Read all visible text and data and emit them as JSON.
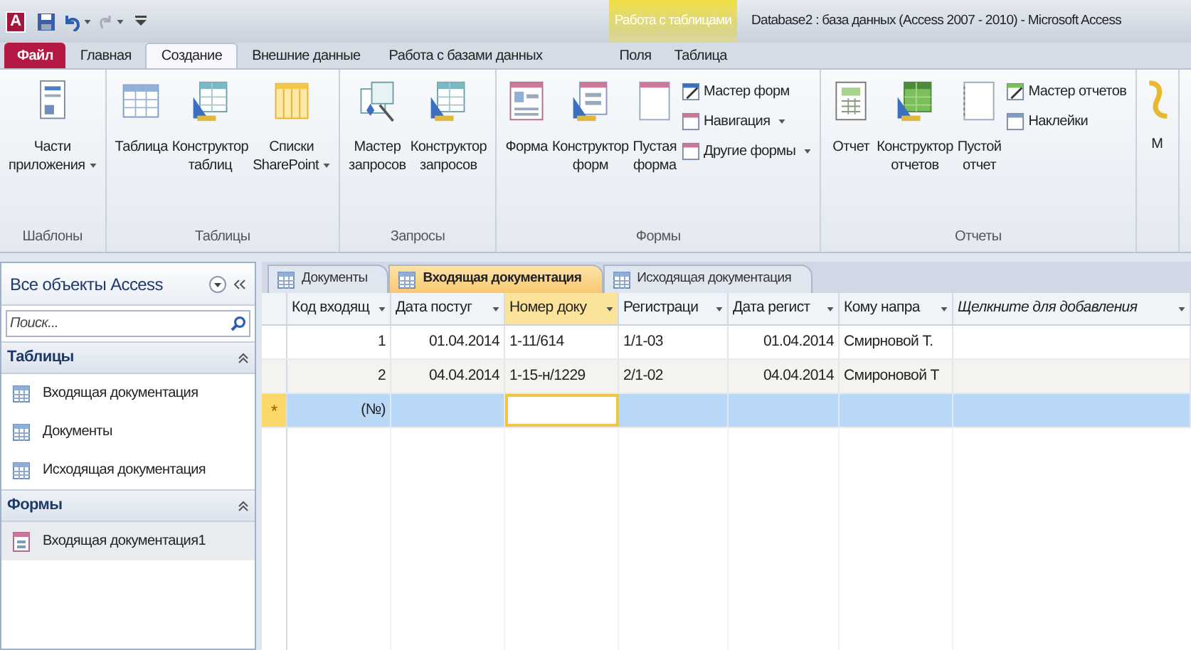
{
  "title_bar": {
    "app_logo": "A",
    "context_group": "Работа с таблицами",
    "title": "Database2 : база данных (Access 2007 - 2010)  -  Microsoft Access"
  },
  "ribbon_tabs": [
    {
      "label": "Файл",
      "kind": "file",
      "selected": false
    },
    {
      "label": "Главная",
      "kind": "normal",
      "selected": false
    },
    {
      "label": "Создание",
      "kind": "normal",
      "selected": true
    },
    {
      "label": "Внешние данные",
      "kind": "normal",
      "selected": false
    },
    {
      "label": "Работа с базами данных",
      "kind": "normal",
      "selected": false
    },
    {
      "label": "Поля",
      "kind": "context",
      "selected": false
    },
    {
      "label": "Таблица",
      "kind": "context",
      "selected": false
    }
  ],
  "ribbon_groups": [
    {
      "label": "Шаблоны",
      "buttons": [
        {
          "lines": [
            "Части",
            "приложения"
          ],
          "dropdown": true
        }
      ]
    },
    {
      "label": "Таблицы",
      "buttons": [
        {
          "lines": [
            "Таблица"
          ],
          "dropdown": false
        },
        {
          "lines": [
            "Конструктор",
            "таблиц"
          ],
          "dropdown": false
        },
        {
          "lines": [
            "Списки",
            "SharePoint"
          ],
          "dropdown": true
        }
      ]
    },
    {
      "label": "Запросы",
      "buttons": [
        {
          "lines": [
            "Мастер",
            "запросов"
          ],
          "dropdown": false
        },
        {
          "lines": [
            "Конструктор",
            "запросов"
          ],
          "dropdown": false
        }
      ]
    },
    {
      "label": "Формы",
      "buttons": [
        {
          "lines": [
            "Форма"
          ],
          "dropdown": false
        },
        {
          "lines": [
            "Конструктор",
            "форм"
          ],
          "dropdown": false
        },
        {
          "lines": [
            "Пустая",
            "форма"
          ],
          "dropdown": false
        }
      ],
      "small_buttons": [
        {
          "label": "Мастер форм",
          "dropdown": false
        },
        {
          "label": "Навигация",
          "dropdown": true
        },
        {
          "label": "Другие формы",
          "dropdown": true
        }
      ]
    },
    {
      "label": "Отчеты",
      "buttons": [
        {
          "lines": [
            "Отчет"
          ],
          "dropdown": false
        },
        {
          "lines": [
            "Конструктор",
            "отчетов"
          ],
          "dropdown": false
        },
        {
          "lines": [
            "Пустой",
            "отчет"
          ],
          "dropdown": false
        }
      ],
      "small_buttons": [
        {
          "label": "Мастер отчетов",
          "dropdown": false
        },
        {
          "label": "Наклейки",
          "dropdown": false
        }
      ]
    },
    {
      "buttons": [
        {
          "lines": [
            "М"
          ],
          "dropdown": false
        }
      ]
    }
  ],
  "nav_pane": {
    "title": "Все объекты Access",
    "search": {
      "placeholder": "Поиск..."
    },
    "groups": [
      {
        "label": "Таблицы",
        "expanded": true,
        "items": [
          {
            "label": "Входящая документация",
            "kind": "table",
            "selected": false
          },
          {
            "label": "Документы",
            "kind": "table",
            "selected": false
          },
          {
            "label": "Исходящая документация",
            "kind": "table",
            "selected": false
          }
        ]
      },
      {
        "label": "Формы",
        "expanded": true,
        "items": [
          {
            "label": "Входящая документация1",
            "kind": "form",
            "selected": true
          }
        ]
      }
    ]
  },
  "doc_tabs": [
    {
      "label": "Документы",
      "selected": false
    },
    {
      "label": "Входящая документация",
      "selected": true
    },
    {
      "label": "Исходящая документация",
      "selected": false
    }
  ],
  "table": {
    "columns": [
      {
        "label": "Код входящ",
        "kind": "number",
        "selected": false
      },
      {
        "label": "Дата постуг",
        "kind": "date",
        "selected": false
      },
      {
        "label": "Номер доку",
        "kind": "text",
        "selected": true
      },
      {
        "label": "Регистраци",
        "kind": "text",
        "selected": false
      },
      {
        "label": "Дата регист",
        "kind": "date",
        "selected": false
      },
      {
        "label": "Кому напра",
        "kind": "text",
        "selected": false
      },
      {
        "label": "Щелкните для добавления",
        "kind": "add",
        "selected": false
      }
    ],
    "rows": [
      {
        "current": false,
        "cells": [
          {
            "text": "1",
            "active": false
          },
          {
            "text": "01.04.2014",
            "active": false
          },
          {
            "text": "1-11/614",
            "active": false
          },
          {
            "text": "1/1-03",
            "active": false
          },
          {
            "text": "01.04.2014",
            "active": false
          },
          {
            "text": "Смирновой Т.",
            "active": false
          },
          {
            "active": false
          }
        ]
      },
      {
        "current": false,
        "cells": [
          {
            "text": "2",
            "active": false
          },
          {
            "text": "04.04.2014",
            "active": false
          },
          {
            "text": "1-15-н/1229",
            "active": false
          },
          {
            "text": "2/1-02",
            "active": false
          },
          {
            "text": "04.04.2014",
            "active": false
          },
          {
            "text": "Смироновой Т",
            "active": false
          },
          {
            "active": false
          }
        ]
      },
      {
        "current": true,
        "marker": "*",
        "cells": [
          {
            "text": "(№)",
            "active": false
          },
          {
            "active": false
          },
          {
            "active": true
          },
          {
            "active": false
          },
          {
            "active": false
          },
          {
            "active": false
          },
          {
            "active": false
          }
        ]
      }
    ]
  }
}
